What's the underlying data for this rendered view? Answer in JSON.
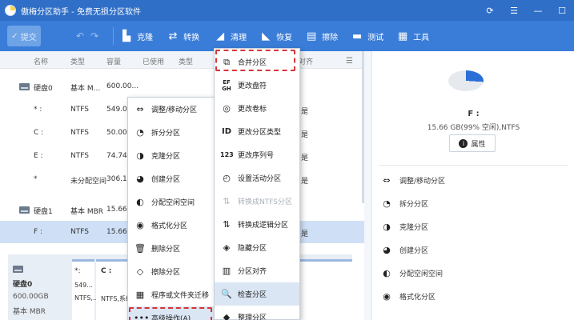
{
  "titlebar": {
    "title": "傲梅分区助手 - 免费无损分区软件",
    "buttons": [
      "⟳",
      "☰",
      "—",
      "☐"
    ]
  },
  "toolbar": {
    "commit": "提交",
    "items": [
      {
        "label": "克隆",
        "icon": "clone-icon"
      },
      {
        "label": "转换",
        "icon": "convert-icon"
      },
      {
        "label": "清理",
        "icon": "clean-icon"
      },
      {
        "label": "恢复",
        "icon": "recover-icon"
      },
      {
        "label": "擦除",
        "icon": "wipe-icon"
      },
      {
        "label": "测试",
        "icon": "test-icon"
      },
      {
        "label": "工具",
        "icon": "tools-icon"
      }
    ]
  },
  "table": {
    "headers": [
      "名称",
      "类型",
      "容量",
      "已使用",
      "类型",
      "对齐"
    ],
    "rows": [
      {
        "name": "硬盘0",
        "type": "基本 M...",
        "cap": "600.00...",
        "last": ""
      },
      {
        "name": "* :",
        "type": "NTFS",
        "cap": "549.00...",
        "last": "是"
      },
      {
        "name": "C :",
        "type": "NTFS",
        "cap": "50.00...",
        "last": "是"
      },
      {
        "name": "E :",
        "type": "NTFS",
        "cap": "74.74...",
        "last": "是"
      },
      {
        "name": "*",
        "type": "未分配空间",
        "cap": "306.11...",
        "last": "是"
      },
      {
        "name": "硬盘1",
        "type": "基本 MBR",
        "cap": "15.66...",
        "last": ""
      },
      {
        "name": "F :",
        "type": "NTFS",
        "cap": "15.66...",
        "last": "是"
      }
    ]
  },
  "diskmap": {
    "disk_label": "硬盘0",
    "disk_size": "600.00GB",
    "disk_type": "基本 MBR",
    "p1": "*:",
    "p1_size": "549...",
    "p1_fs": "NTFS,...",
    "p2": "C :",
    "p2_fs": "NTFS,系统,主"
  },
  "menu_left": [
    {
      "label": "调整/移动分区",
      "icon": "resize-icon"
    },
    {
      "label": "拆分分区",
      "icon": "split-icon"
    },
    {
      "label": "克隆分区",
      "icon": "clone-partition-icon"
    },
    {
      "label": "创建分区",
      "icon": "create-icon"
    },
    {
      "label": "分配空闲空间",
      "icon": "allocate-icon"
    },
    {
      "label": "格式化分区",
      "icon": "format-icon"
    },
    {
      "label": "删除分区",
      "icon": "delete-icon"
    },
    {
      "label": "擦除分区",
      "icon": "erase-icon"
    },
    {
      "label": "程序或文件夹迁移",
      "icon": "migrate-icon"
    },
    {
      "label": "高级操作(A)",
      "icon": "more-icon"
    }
  ],
  "menu_right": [
    {
      "label": "合并分区",
      "icon": "merge-icon",
      "disabled": false
    },
    {
      "label": "更改盘符",
      "icon": "drive-letter-icon",
      "disabled": false
    },
    {
      "label": "更改卷标",
      "icon": "label-icon",
      "disabled": false
    },
    {
      "label": "更改分区类型",
      "icon": "id-icon",
      "disabled": false
    },
    {
      "label": "更改序列号",
      "icon": "serial-icon",
      "disabled": false
    },
    {
      "label": "设置活动分区",
      "icon": "active-icon",
      "disabled": false
    },
    {
      "label": "转换成NTFS分区",
      "icon": "ntfs-icon",
      "disabled": true
    },
    {
      "label": "转换成逻辑分区",
      "icon": "logical-icon",
      "disabled": false
    },
    {
      "label": "隐藏分区",
      "icon": "hide-icon",
      "disabled": false
    },
    {
      "label": "分区对齐",
      "icon": "align-icon",
      "disabled": false
    },
    {
      "label": "检查分区",
      "icon": "check-icon",
      "disabled": false
    },
    {
      "label": "整理分区",
      "icon": "defrag-icon",
      "disabled": false
    }
  ],
  "panel": {
    "name": "F :",
    "info": "15.66 GB(99% 空闲),NTFS",
    "prop": "属性",
    "items": [
      {
        "label": "调整/移动分区",
        "icon": "resize-icon"
      },
      {
        "label": "拆分分区",
        "icon": "split-icon"
      },
      {
        "label": "克隆分区",
        "icon": "clone-partition-icon"
      },
      {
        "label": "创建分区",
        "icon": "create-icon"
      },
      {
        "label": "分配空闲空间",
        "icon": "allocate-icon"
      },
      {
        "label": "格式化分区",
        "icon": "format-icon"
      }
    ]
  },
  "colors": {
    "titlebar": "#2f6fc7",
    "toolbar": "#3a7dd8",
    "selection": "#cfe0f6",
    "highlight_dash": "#d8343a"
  }
}
